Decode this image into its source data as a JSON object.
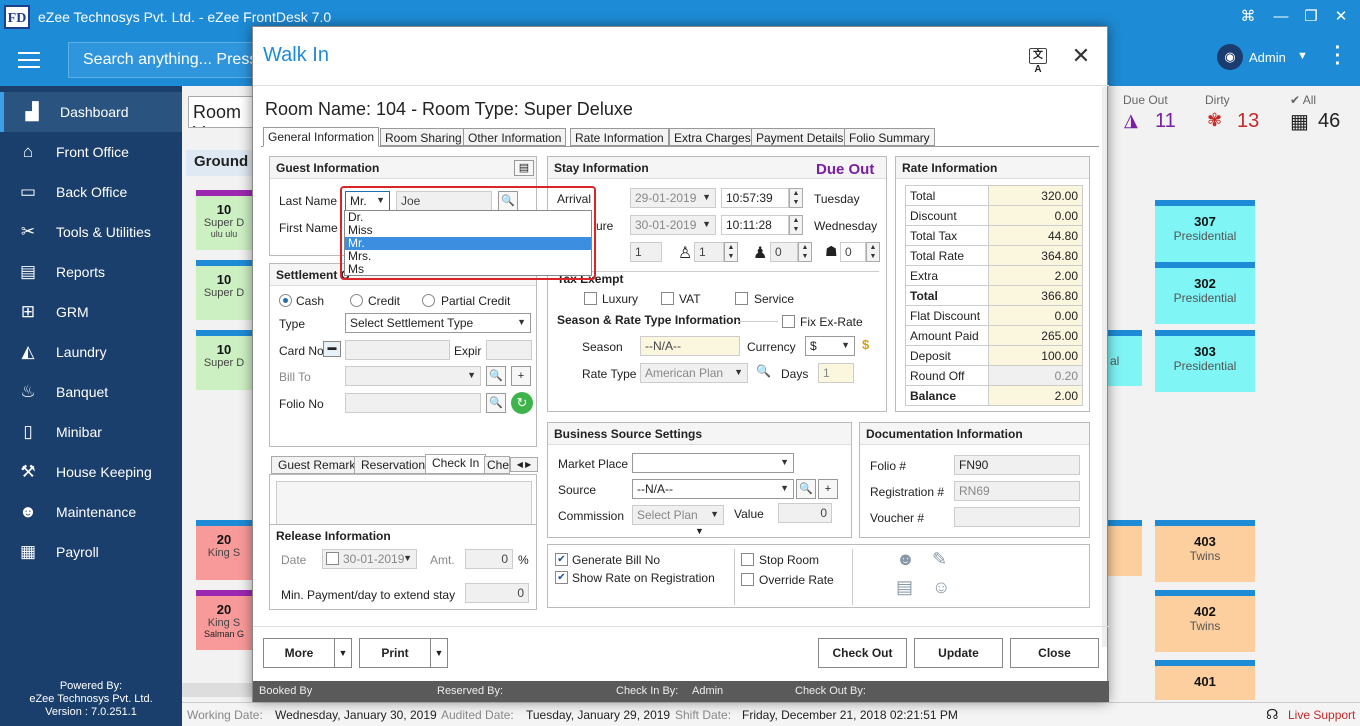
{
  "app": {
    "logo": "FD",
    "title": "eZee Technosys Pvt. Ltd. - eZee FrontDesk 7.0"
  },
  "topbar": {
    "search_placeholder": "Search anything... Press",
    "user": "Admin",
    "avatar_icon": "user-icon"
  },
  "sidebar": {
    "items": [
      {
        "label": "Dashboard",
        "icon": "chart-icon"
      },
      {
        "label": "Front Office",
        "icon": "desk-icon"
      },
      {
        "label": "Back Office",
        "icon": "monitor-icon"
      },
      {
        "label": "Tools & Utilities",
        "icon": "tools-icon"
      },
      {
        "label": "Reports",
        "icon": "report-icon"
      },
      {
        "label": "GRM",
        "icon": "grm-icon"
      },
      {
        "label": "Laundry",
        "icon": "iron-icon"
      },
      {
        "label": "Banquet",
        "icon": "banquet-icon"
      },
      {
        "label": "Minibar",
        "icon": "fridge-icon"
      },
      {
        "label": "House Keeping",
        "icon": "broom-icon"
      },
      {
        "label": "Maintenance",
        "icon": "worker-icon"
      },
      {
        "label": "Payroll",
        "icon": "payroll-icon"
      }
    ],
    "powered_by": "Powered By:",
    "company": "eZee Technosys Pvt. Ltd.",
    "version": "Version : 7.0.251.1"
  },
  "background": {
    "room_view": "Room V",
    "ground": "Ground",
    "stats": {
      "due_out_label": "Due Out",
      "due_out": "11",
      "dirty_label": "Dirty",
      "dirty": "13",
      "all_label": "All",
      "all": "46"
    },
    "left_rooms": [
      {
        "num": "10",
        "type": "Super D",
        "extra": "ulu ulu"
      },
      {
        "num": "10",
        "type": "Super D",
        "extra": ""
      },
      {
        "num": "10",
        "type": "Super D",
        "extra": ""
      },
      {
        "num": "20",
        "type": "King S",
        "extra": ""
      },
      {
        "num": "20",
        "type": "King S",
        "extra": "Salman G"
      }
    ],
    "right_rooms": [
      {
        "num": "307",
        "type": "Presidential"
      },
      {
        "num": "302",
        "type": "Presidential"
      },
      {
        "num": "303",
        "type": "Presidential"
      },
      {
        "num": "403",
        "type": "Twins"
      },
      {
        "num": "402",
        "type": "Twins"
      },
      {
        "num": "401",
        "type": ""
      }
    ],
    "partial_right": "al"
  },
  "statusbar": {
    "working_date_label": "Working Date:",
    "working_date": "Wednesday, January 30, 2019",
    "audited_date_label": "Audited Date:",
    "audited_date": "Tuesday, January 29, 2019",
    "shift_date_label": "Shift Date:",
    "shift_date": "Friday, December 21, 2018 02:21:51 PM",
    "live_support": "Live Support"
  },
  "modal": {
    "title": "Walk In",
    "room_heading": "Room Name: 104 - Room Type: Super Deluxe",
    "tabs": [
      "General Information",
      "Room Sharing",
      "Other Information",
      "Rate Information",
      "Extra Charges",
      "Payment Details",
      "Folio Summary"
    ],
    "guest": {
      "header": "Guest Information",
      "last_name_label": "Last Name",
      "first_name_label": "First Name",
      "title_value": "Mr.",
      "last_name": "Joe",
      "title_options": [
        "Dr.",
        "Miss",
        "Mr.",
        "Mrs.",
        "Ms"
      ]
    },
    "settlement": {
      "header": "Settlement Option",
      "header_visible": "Settlement O",
      "cash": "Cash",
      "credit": "Credit",
      "partial_credit": "Partial Credit",
      "type_label": "Type",
      "type_value": "Select Settlement Type",
      "card_no_label": "Card No",
      "expiry_label": "Expir",
      "bill_to_label": "Bill To",
      "folio_no_label": "Folio No"
    },
    "remark_tabs": [
      "Guest Remark",
      "Reservation",
      "Check In",
      "Che"
    ],
    "release": {
      "header": "Release Information",
      "date_label": "Date",
      "date": "30-01-2019",
      "amt_label": "Amt.",
      "amt": "0",
      "pct": "%",
      "min_payment_label": "Min. Payment/day to extend stay",
      "min_payment": "0"
    },
    "stay": {
      "header": "Stay Information",
      "due_out": "Due Out",
      "arrival_label": "Arrival",
      "arrival_date": "29-01-2019",
      "arrival_time": "10:57:39",
      "arrival_day": "Tuesday",
      "departure_label": "ure",
      "departure_date": "30-01-2019",
      "departure_time": "10:11:28",
      "departure_day": "Wednesday",
      "nights": "1",
      "adults": "1",
      "children": "0",
      "infants": "0",
      "tax_exempt_label": "Tax Exempt",
      "tax_exempt_visible": "Tax Exempt",
      "luxury": "Luxury",
      "vat": "VAT",
      "service": "Service",
      "season_header": "Season & Rate Type Information",
      "fix_ex_rate": "Fix Ex-Rate",
      "season_label": "Season",
      "season": "--N/A--",
      "currency_label": "Currency",
      "currency": "$",
      "rate_type_label": "Rate Type",
      "rate_type": "American Plan",
      "days_label": "Days",
      "days": "1"
    },
    "rate": {
      "header": "Rate Information",
      "rows": [
        {
          "k": "Total",
          "v": "320.00",
          "bold": false,
          "grey": false
        },
        {
          "k": "Discount",
          "v": "0.00",
          "bold": false,
          "grey": false
        },
        {
          "k": "Total Tax",
          "v": "44.80",
          "bold": false,
          "grey": false
        },
        {
          "k": "Total Rate",
          "v": "364.80",
          "bold": false,
          "grey": false
        },
        {
          "k": "Extra",
          "v": "2.00",
          "bold": false,
          "grey": false
        },
        {
          "k": "Total",
          "v": "366.80",
          "bold": true,
          "grey": false
        },
        {
          "k": "Flat Discount",
          "v": "0.00",
          "bold": false,
          "grey": false
        },
        {
          "k": "Amount Paid",
          "v": "265.00",
          "bold": false,
          "grey": false
        },
        {
          "k": "Deposit",
          "v": "100.00",
          "bold": false,
          "grey": false
        },
        {
          "k": "Round Off",
          "v": "0.20",
          "bold": false,
          "grey": true
        },
        {
          "k": "Balance",
          "v": "2.00",
          "bold": true,
          "grey": false
        }
      ]
    },
    "business": {
      "header": "Business Source Settings",
      "market_label": "Market Place",
      "market": "",
      "source_label": "Source",
      "source": "--N/A--",
      "commission_label": "Commission",
      "commission": "Select Plan",
      "value_label": "Value",
      "value": "0"
    },
    "documentation": {
      "header": "Documentation Information",
      "folio_label": "Folio #",
      "folio": "FN90",
      "reg_label": "Registration #",
      "reg": "RN69",
      "voucher_label": "Voucher #",
      "voucher": ""
    },
    "options": {
      "generate_bill": "Generate Bill No",
      "show_rate": "Show Rate on Registration",
      "stop_room": "Stop Room",
      "override_rate": "Override Rate"
    },
    "buttons": {
      "more": "More",
      "print": "Print",
      "check_out": "Check Out",
      "update": "Update",
      "close": "Close"
    },
    "footer": {
      "booked_by": "Booked By",
      "reserved_by": "Reserved By:",
      "checkin_by": "Check In By:",
      "checkin_user": "Admin",
      "checkout_by": "Check Out By:"
    }
  },
  "colors": {
    "brand": "#1e8bd6",
    "sidebar": "#1b3f6c",
    "due_out": "#7a1fa2",
    "dirty": "#c62828",
    "highlight": "#d9252a"
  }
}
